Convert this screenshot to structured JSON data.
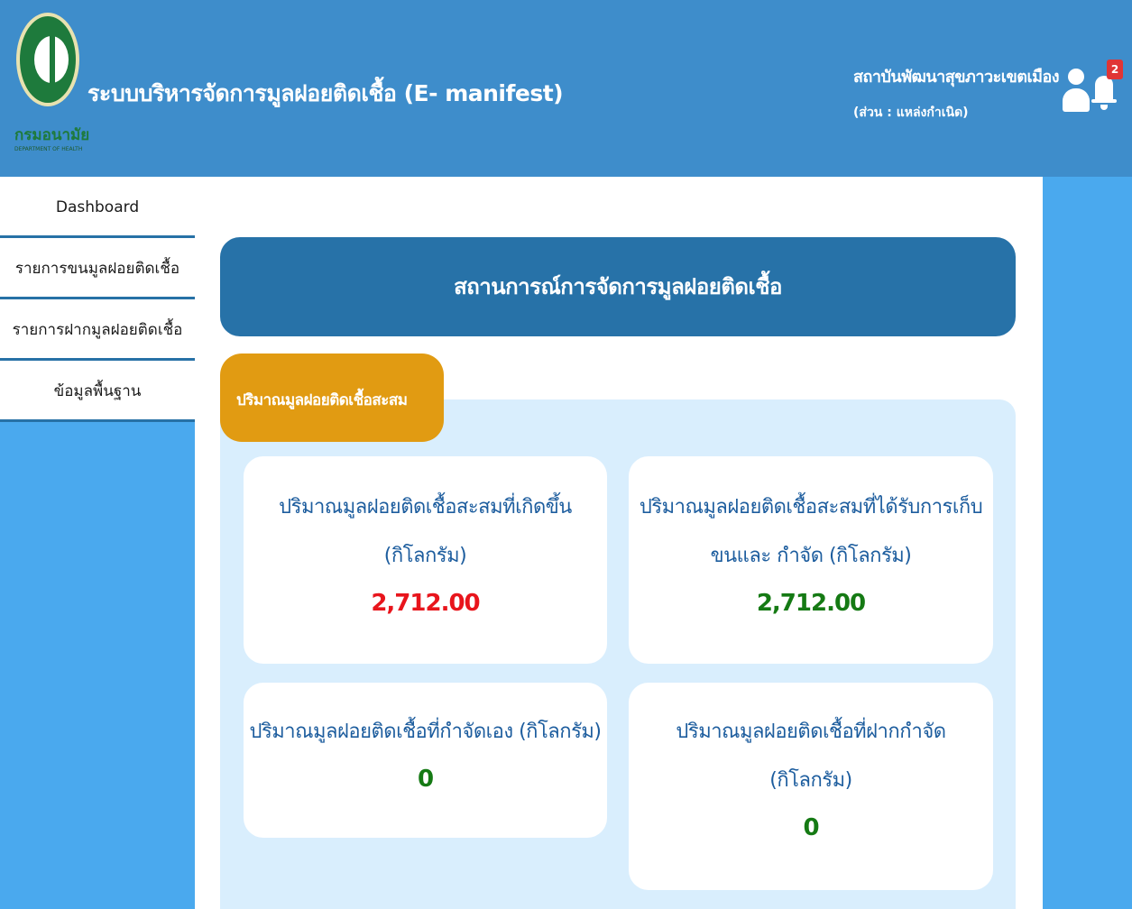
{
  "header": {
    "app_title": "ระบบบริหารจัดการมูลฝอยติดเชื้อ (E- manifest)",
    "logo_text": "กรมอนามัย",
    "logo_sub": "DEPARTMENT OF HEALTH",
    "org_name": "สถาบันพัฒนาสุขภาวะเขตเมือง",
    "org_role": "(ส่วน : แหล่งกำเนิด)",
    "notification_count": "2"
  },
  "sidebar": {
    "items": [
      {
        "label": "Dashboard"
      },
      {
        "label": "รายการขนมูลฝอยติดเชื้อ"
      },
      {
        "label": "รายการฝากมูลฝอยติดเชื้อ"
      },
      {
        "label": "ข้อมูลพื้นฐาน"
      }
    ]
  },
  "main": {
    "banner_title": "สถานการณ์การจัดการมูลฝอยติดเชื้อ",
    "tab_label": "ปริมาณมูลฝอยติดเชื้อสะสม",
    "cards": [
      {
        "line1": "ปริมาณมูลฝอยติดเชื้อสะสมที่เกิดขึ้น",
        "line2": "(กิโลกรัม)",
        "value": "2,712.00"
      },
      {
        "line1": "ปริมาณมูลฝอยติดเชื้อสะสมที่ได้รับการเก็บ",
        "line2": "ขนและ กำจัด (กิโลกรัม)",
        "value": "2,712.00"
      },
      {
        "line1": "ปริมาณมูลฝอยติดเชื้อที่กำจัดเอง (กิโลกรัม)",
        "value": "0"
      },
      {
        "line1": "ปริมาณมูลฝอยติดเชื้อที่ฝากกำจัด",
        "line2": "(กิโลกรัม)",
        "value": "0"
      }
    ]
  },
  "colors": {
    "header_bg": "#3e8dcb",
    "banner_bg": "#2772a8",
    "tab_bg": "#e19b12",
    "value_red": "#e8151c",
    "value_green": "#157a14"
  }
}
